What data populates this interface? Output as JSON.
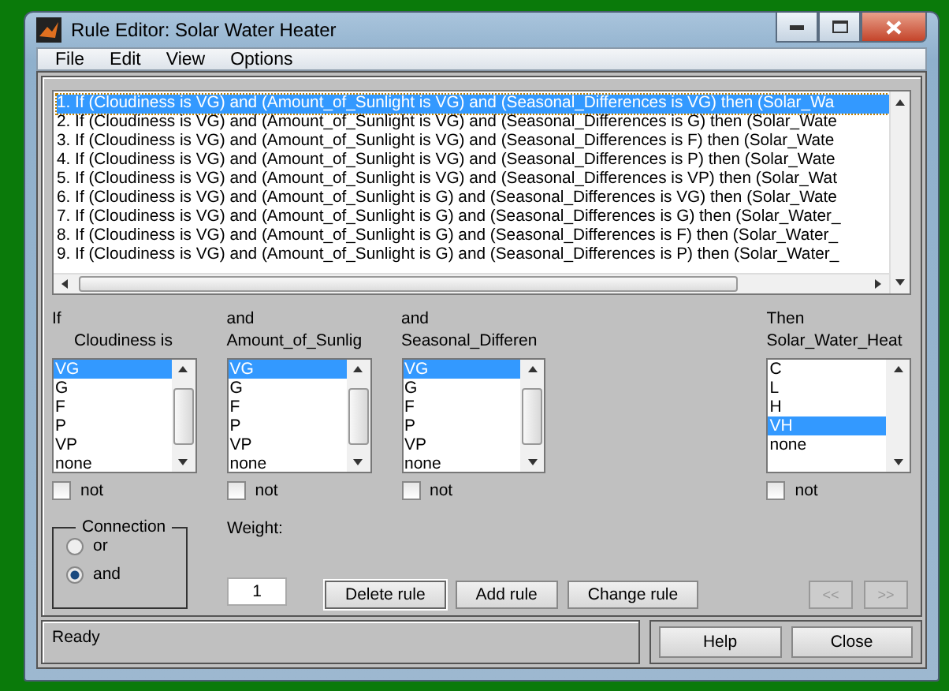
{
  "window": {
    "title": "Rule Editor: Solar Water Heater"
  },
  "menu": [
    "File",
    "Edit",
    "View",
    "Options"
  ],
  "rules": [
    {
      "text": "1. If (Cloudiness is VG) and (Amount_of_Sunlight is VG) and (Seasonal_Differences is VG) then (Solar_Wa",
      "selected": true
    },
    {
      "text": "2. If (Cloudiness is VG) and (Amount_of_Sunlight is VG) and (Seasonal_Differences is G) then (Solar_Wate",
      "selected": false
    },
    {
      "text": "3. If (Cloudiness is VG) and (Amount_of_Sunlight is VG) and (Seasonal_Differences is F) then (Solar_Wate",
      "selected": false
    },
    {
      "text": "4. If (Cloudiness is VG) and (Amount_of_Sunlight is VG) and (Seasonal_Differences is P) then (Solar_Wate",
      "selected": false
    },
    {
      "text": "5. If (Cloudiness is VG) and (Amount_of_Sunlight is VG) and (Seasonal_Differences is VP) then (Solar_Wat",
      "selected": false
    },
    {
      "text": "6. If (Cloudiness is VG) and (Amount_of_Sunlight is G) and (Seasonal_Differences is VG) then (Solar_Wate",
      "selected": false
    },
    {
      "text": "7. If (Cloudiness is VG) and (Amount_of_Sunlight is G) and (Seasonal_Differences is G) then (Solar_Water_",
      "selected": false
    },
    {
      "text": "8. If (Cloudiness is VG) and (Amount_of_Sunlight is G) and (Seasonal_Differences is F) then (Solar_Water_",
      "selected": false
    },
    {
      "text": "9. If (Cloudiness is VG) and (Amount_of_Sunlight is G) and (Seasonal_Differences is P) then (Solar_Water_",
      "selected": false
    }
  ],
  "inputs": [
    {
      "prefix": "If",
      "name": "Cloudiness is",
      "not_label": "not",
      "not": false,
      "options": [
        {
          "label": "VG",
          "selected": true
        },
        {
          "label": "G",
          "selected": false
        },
        {
          "label": "F",
          "selected": false
        },
        {
          "label": "P",
          "selected": false
        },
        {
          "label": "VP",
          "selected": false
        },
        {
          "label": "none",
          "selected": false
        }
      ]
    },
    {
      "prefix": "and",
      "name": "Amount_of_Sunlig",
      "not_label": "not",
      "not": false,
      "options": [
        {
          "label": "VG",
          "selected": true
        },
        {
          "label": "G",
          "selected": false
        },
        {
          "label": "F",
          "selected": false
        },
        {
          "label": "P",
          "selected": false
        },
        {
          "label": "VP",
          "selected": false
        },
        {
          "label": "none",
          "selected": false
        }
      ]
    },
    {
      "prefix": "and",
      "name": "Seasonal_Differen",
      "not_label": "not",
      "not": false,
      "options": [
        {
          "label": "VG",
          "selected": true
        },
        {
          "label": "G",
          "selected": false
        },
        {
          "label": "F",
          "selected": false
        },
        {
          "label": "P",
          "selected": false
        },
        {
          "label": "VP",
          "selected": false
        },
        {
          "label": "none",
          "selected": false
        }
      ]
    }
  ],
  "output": {
    "prefix": "Then",
    "name": "Solar_Water_Heat",
    "not_label": "not",
    "not": false,
    "options": [
      {
        "label": "C",
        "selected": false
      },
      {
        "label": "L",
        "selected": false
      },
      {
        "label": "H",
        "selected": false
      },
      {
        "label": "VH",
        "selected": true
      },
      {
        "label": "none",
        "selected": false
      }
    ]
  },
  "connection": {
    "title": "Connection",
    "options": [
      {
        "label": "or",
        "selected": false
      },
      {
        "label": "and",
        "selected": true
      }
    ]
  },
  "weight": {
    "label": "Weight:",
    "value": "1"
  },
  "actions": [
    {
      "label": "Delete rule",
      "focused": true
    },
    {
      "label": "Add rule",
      "focused": false
    },
    {
      "label": "Change rule",
      "focused": false
    }
  ],
  "nav": [
    {
      "label": "<<",
      "disabled": true
    },
    {
      "label": ">>",
      "disabled": true
    }
  ],
  "status": "Ready",
  "footer_buttons": [
    "Help",
    "Close"
  ]
}
